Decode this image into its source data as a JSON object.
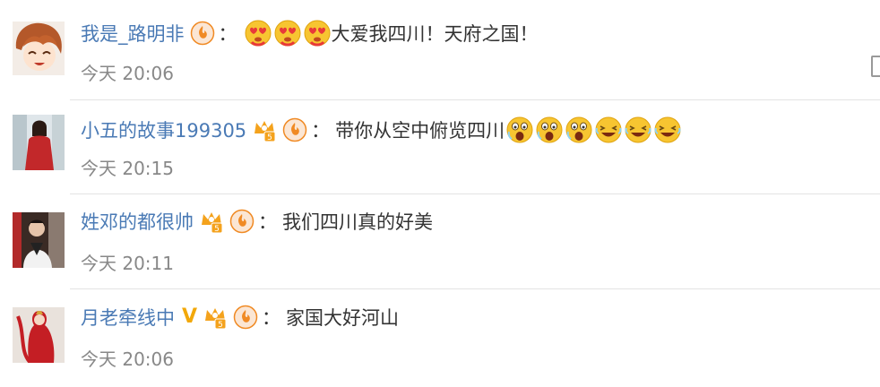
{
  "comments": [
    {
      "username": "我是_路明非",
      "text": "大爱我四川！天府之国！",
      "time": "今天 20:06"
    },
    {
      "username": "小五的故事199305",
      "text": "带你从空中俯览四川",
      "time": "今天 20:15"
    },
    {
      "username": "姓邓的都很帅",
      "text": "我们四川真的好美",
      "time": "今天 20:11"
    },
    {
      "username": "月老牵线中",
      "verified_mark": "V",
      "text": "家国大好河山",
      "time": "今天 20:06"
    }
  ],
  "separator": "：",
  "colors": {
    "username": "#4a7ab5",
    "time": "#888888",
    "text": "#333333",
    "divider": "#e3e3e3",
    "emoji_yellow": "#f7c531",
    "badge_orange": "#f08a24",
    "verified": "#f2a80a"
  },
  "icons": [
    "fire-badge-icon",
    "member-crown-icon",
    "love-heart-eyes-emoji",
    "scared-face-emoji",
    "laughing-face-emoji",
    "more-options-icon"
  ]
}
